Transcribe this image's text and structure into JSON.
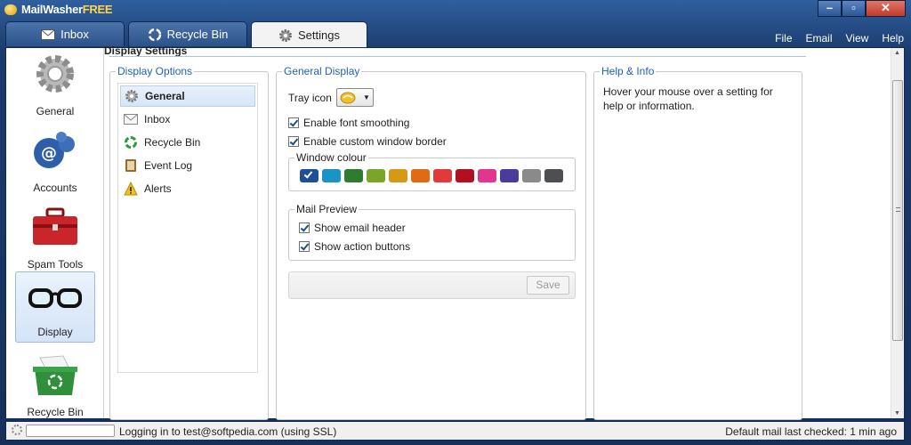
{
  "app": {
    "title_main": "MailWasher",
    "title_free": "FREE"
  },
  "window_controls": {
    "minimize": "–",
    "maximize": "▫",
    "close": "✕"
  },
  "tabs": [
    {
      "label": "Inbox",
      "icon": "envelope-icon"
    },
    {
      "label": "Recycle Bin",
      "icon": "recycle-icon"
    },
    {
      "label": "Settings",
      "icon": "gear-icon"
    }
  ],
  "menu": [
    "File",
    "Email",
    "View",
    "Help"
  ],
  "leftnav": [
    {
      "label": "General",
      "icon": "gear-icon"
    },
    {
      "label": "Accounts",
      "icon": "at-sign-icon"
    },
    {
      "label": "Spam Tools",
      "icon": "toolbox-icon"
    },
    {
      "label": "Display",
      "icon": "glasses-icon"
    },
    {
      "label": "Recycle Bin",
      "icon": "recycle-bin-icon"
    }
  ],
  "page_header": "Display Settings",
  "display_options": {
    "title": "Display Options",
    "items": [
      {
        "label": "General",
        "icon": "gear-icon"
      },
      {
        "label": "Inbox",
        "icon": "envelope-icon"
      },
      {
        "label": "Recycle Bin",
        "icon": "recycle-icon"
      },
      {
        "label": "Event Log",
        "icon": "book-icon"
      },
      {
        "label": "Alerts",
        "icon": "warning-icon"
      }
    ]
  },
  "general_display": {
    "title": "General Display",
    "tray_icon_label": "Tray icon",
    "font_smoothing": "Enable font smoothing",
    "custom_border": "Enable custom window border",
    "window_colour_title": "Window colour",
    "colours": [
      "#1f4f96",
      "#1a93c8",
      "#2e7d2e",
      "#7aa52a",
      "#d39a12",
      "#e06b12",
      "#e03a3a",
      "#b01020",
      "#e0378d",
      "#4b3c9c",
      "#8a8a8a",
      "#4e4f52"
    ],
    "mail_preview_title": "Mail Preview",
    "show_email_header": "Show email header",
    "show_action_buttons": "Show action buttons",
    "save_label": "Save"
  },
  "help_info": {
    "title": "Help & Info",
    "text": "Hover your mouse over a setting for help or information."
  },
  "status": {
    "message": "Logging in to test@softpedia.com (using SSL)",
    "last_checked": "Default mail last checked: 1 min ago"
  }
}
